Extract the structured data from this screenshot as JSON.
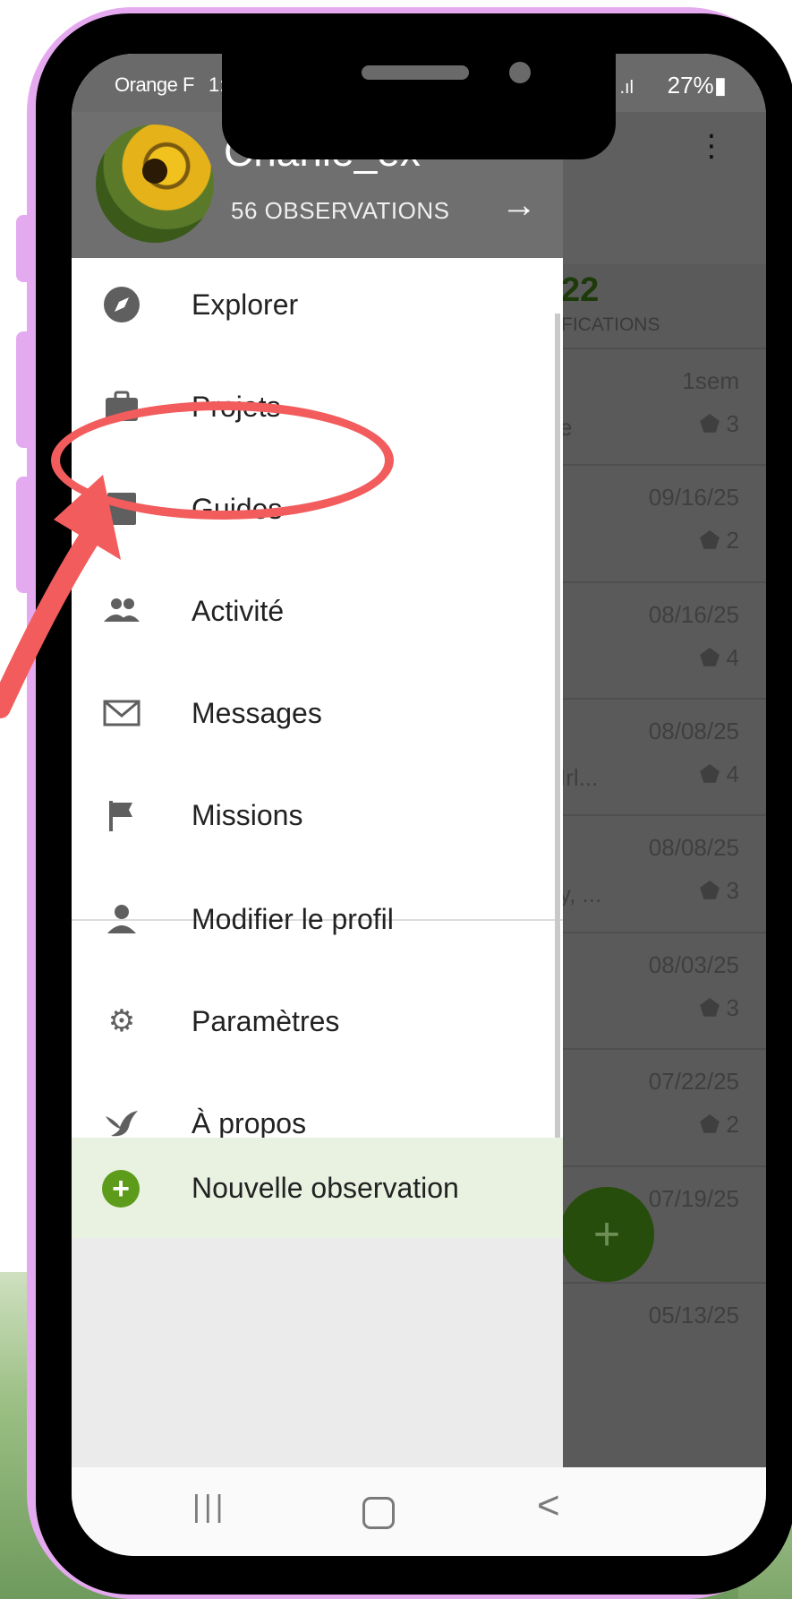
{
  "status_bar": {
    "carrier": "Orange F",
    "time": "1:",
    "signal": "✱ .ıl",
    "battery": "27%"
  },
  "drawer": {
    "username": "Charlie_ex",
    "observations": "56 OBSERVATIONS",
    "items": [
      {
        "label": "Explorer",
        "icon": "compass-icon"
      },
      {
        "label": "Projets",
        "icon": "briefcase-icon"
      },
      {
        "label": "Guides",
        "icon": "book-icon"
      },
      {
        "label": "Activité",
        "icon": "people-icon"
      },
      {
        "label": "Messages",
        "icon": "mail-icon"
      },
      {
        "label": "Missions",
        "icon": "flag-icon"
      },
      {
        "label": "Modifier le profil",
        "icon": "person-icon"
      },
      {
        "label": "Paramètres",
        "icon": "gear-icon"
      },
      {
        "label": "À propos",
        "icon": "bird-icon"
      }
    ],
    "new_observation": "Nouvelle observation"
  },
  "background": {
    "count": "22",
    "count_label": "FICATIONS",
    "rows": [
      {
        "date": "1sem",
        "extra": "e",
        "ids": "3"
      },
      {
        "date": "09/16/25",
        "extra": "",
        "ids": "2"
      },
      {
        "date": "08/16/25",
        "extra": "",
        "ids": "4"
      },
      {
        "date": "08/08/25",
        "extra": "Irl...",
        "ids": "4"
      },
      {
        "date": "08/08/25",
        "extra": "y, ...",
        "ids": "3"
      },
      {
        "date": "08/03/25",
        "extra": "",
        "ids": "3"
      },
      {
        "date": "07/22/25",
        "extra": "",
        "ids": "2"
      },
      {
        "date": "07/19/25",
        "extra": "",
        "ids": ""
      },
      {
        "date": "05/13/25",
        "extra": "",
        "ids": ""
      }
    ],
    "fab": "+"
  },
  "navbar": {
    "recent": "|||",
    "back": "<"
  },
  "colors": {
    "highlight": "#f25c5c",
    "accent_green": "#5d9b1a",
    "phone_frame": "#e5a9f0"
  }
}
